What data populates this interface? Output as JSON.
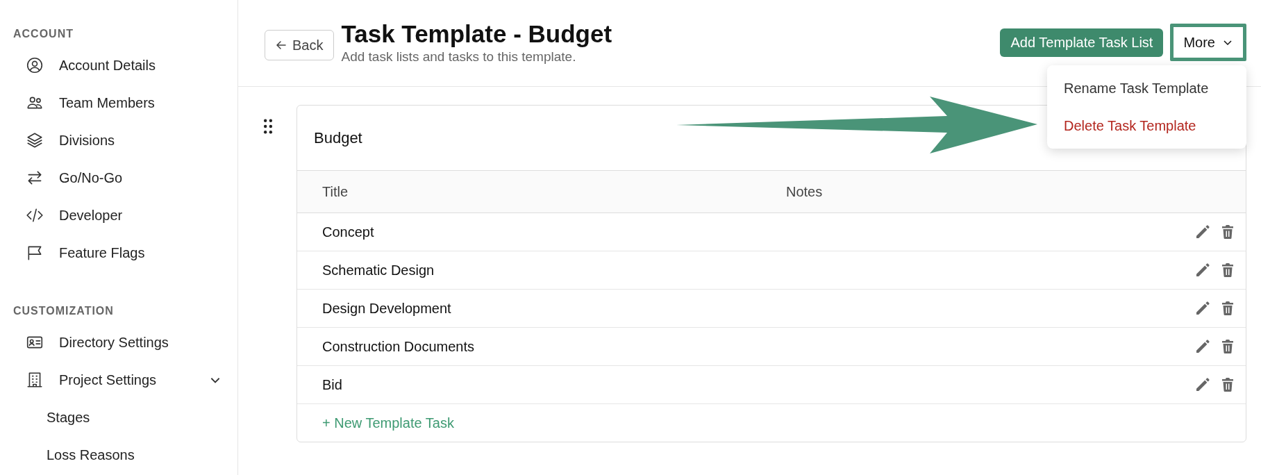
{
  "sidebar": {
    "sections": [
      {
        "heading": "ACCOUNT",
        "items": [
          {
            "label": "Account Details"
          },
          {
            "label": "Team Members"
          },
          {
            "label": "Divisions"
          },
          {
            "label": "Go/No-Go"
          },
          {
            "label": "Developer"
          },
          {
            "label": "Feature Flags"
          }
        ]
      },
      {
        "heading": "CUSTOMIZATION",
        "items": [
          {
            "label": "Directory Settings"
          },
          {
            "label": "Project Settings",
            "expanded": true,
            "children": [
              {
                "label": "Stages"
              },
              {
                "label": "Loss Reasons"
              }
            ]
          }
        ]
      }
    ]
  },
  "header": {
    "back_button": "Back",
    "title": "Task Template - Budget",
    "subtitle": "Add task lists and tasks to this template.",
    "add_button": "Add Template Task List",
    "more_menu": {
      "label": "More",
      "open": true,
      "items": [
        {
          "label": "Rename Task Template",
          "kind": "normal"
        },
        {
          "label": "Delete Task Template",
          "kind": "danger"
        }
      ]
    }
  },
  "task_list": {
    "name": "Budget",
    "columns": [
      "Title",
      "Notes"
    ],
    "rows": [
      {
        "title": "Concept"
      },
      {
        "title": "Schematic Design"
      },
      {
        "title": "Design Development"
      },
      {
        "title": "Construction Documents"
      },
      {
        "title": "Bid"
      }
    ],
    "new_task_link": "+ New Template Task"
  }
}
